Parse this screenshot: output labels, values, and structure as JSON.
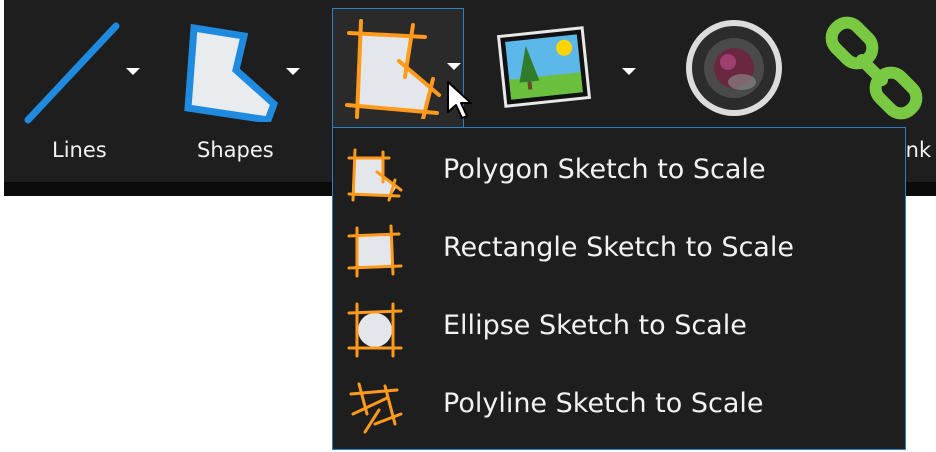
{
  "toolbar": {
    "lines_label": "Lines",
    "shapes_label": "Shapes",
    "partial_label": "link"
  },
  "dropdown": {
    "items": [
      {
        "label": "Polygon Sketch to Scale",
        "icon": "polygon-sketch-icon"
      },
      {
        "label": "Rectangle Sketch to Scale",
        "icon": "rectangle-sketch-icon"
      },
      {
        "label": "Ellipse Sketch to Scale",
        "icon": "ellipse-sketch-icon"
      },
      {
        "label": "Polyline Sketch to Scale",
        "icon": "polyline-sketch-icon"
      }
    ]
  },
  "colors": {
    "accent_blue": "#1f8be0",
    "sketch_orange": "#ff9a1a",
    "link_green": "#7ac943",
    "toolbar_bg": "#1e1e1e",
    "selection_border": "#2f7fc4"
  }
}
